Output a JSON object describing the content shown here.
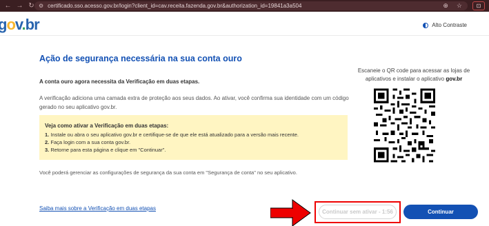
{
  "browser": {
    "url": "certificado.sso.acesso.gov.br/login?client_id=cav.receita.fazenda.gov.br&authorization_id=19841a3a504"
  },
  "header": {
    "logo_g": "g",
    "logo_o": "o",
    "logo_v": "v",
    "logo_dot": ".",
    "logo_br": "br",
    "contrast_label": "Alto Contraste"
  },
  "main": {
    "title": "Ação de segurança necessária na sua conta ouro",
    "lead": "A conta ouro agora necessita da Verificação em duas etapas.",
    "paragraph": "A verificação adiciona uma camada extra de proteção aos seus dados. Ao ativar, você confirma sua identidade com um código gerado no seu aplicativo gov.br.",
    "howto_title": "Veja como ativar a Verificação em duas etapas:",
    "steps": [
      {
        "num": "1.",
        "text": "Instale ou abra o seu aplicativo gov.br e certifique-se de que ele está atualizado para a versão mais recente."
      },
      {
        "num": "2.",
        "text": "Faça login com a sua conta gov.br."
      },
      {
        "num": "3.",
        "text": "Retorne para esta página e clique em \"Continuar\"."
      }
    ],
    "manage_text": "Você poderá gerenciar as configurações de segurança da sua conta em \"Segurança de conta\" no seu aplicativo."
  },
  "qr": {
    "caption": "Escaneie o QR code para acessar as lojas de aplicativos e instalar o aplicativo",
    "caption_bold": "gov.br"
  },
  "footer": {
    "learn_more": "Saiba mais sobre a Verificação em duas etapas",
    "skip_button": "Continuar sem ativar - 1:56",
    "continue_button": "Continuar"
  },
  "colors": {
    "primary": "#1351b4",
    "notice_bg": "#fff5c2",
    "highlight": "#e00000"
  }
}
